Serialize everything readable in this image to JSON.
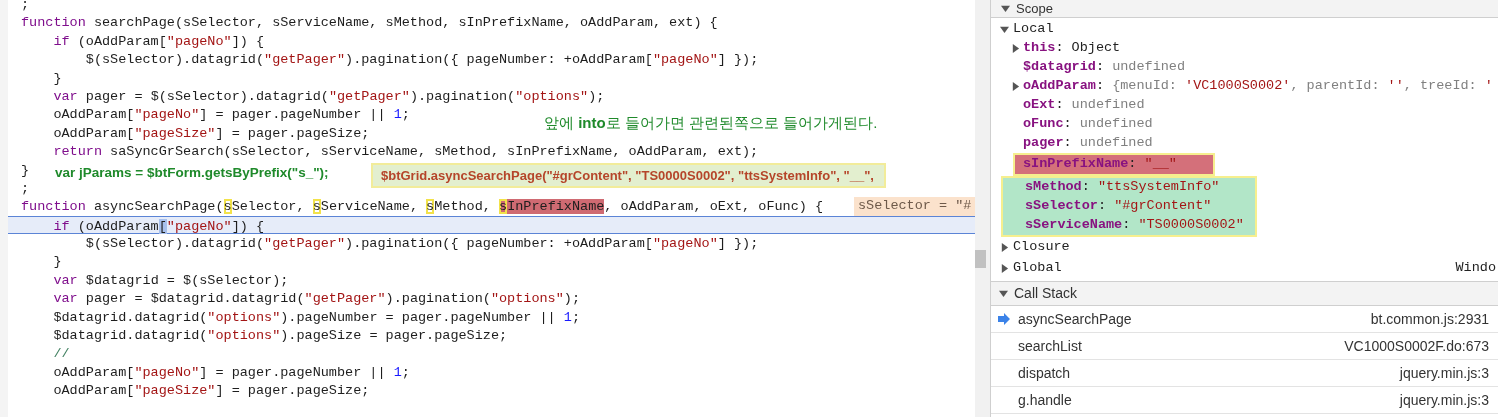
{
  "editor": {
    "lines": [
      {
        "current": false,
        "tokens": [
          {
            "t": ";"
          }
        ]
      },
      {
        "current": false,
        "tokens": [
          {
            "t": "function",
            "kind": "keyword"
          },
          {
            "t": " searchPage(sSelector, sServiceName, sMethod, sInPrefixName, oAddParam, ext) {"
          }
        ]
      },
      {
        "current": false,
        "tokens": [
          {
            "t": "    if",
            "kind": "keyword"
          },
          {
            "t": " (oAddParam["
          },
          {
            "t": "\"pageNo\"",
            "kind": "string"
          },
          {
            "t": "]) {"
          }
        ]
      },
      {
        "current": false,
        "tokens": [
          {
            "t": "        $(sSelector).datagrid("
          },
          {
            "t": "\"getPager\"",
            "kind": "string"
          },
          {
            "t": ").pagination({ pageNumber: +oAddParam["
          },
          {
            "t": "\"pageNo\"",
            "kind": "string"
          },
          {
            "t": "] });"
          }
        ]
      },
      {
        "current": false,
        "tokens": [
          {
            "t": "    }"
          }
        ]
      },
      {
        "current": false,
        "tokens": [
          {
            "t": "    var",
            "kind": "keyword"
          },
          {
            "t": " pager = $(sSelector).datagrid("
          },
          {
            "t": "\"getPager\"",
            "kind": "string"
          },
          {
            "t": ").pagination("
          },
          {
            "t": "\"options\"",
            "kind": "string"
          },
          {
            "t": ");"
          }
        ]
      },
      {
        "current": false,
        "tokens": [
          {
            "t": "    oAddParam["
          },
          {
            "t": "\"pageNo\"",
            "kind": "string"
          },
          {
            "t": "] = pager.pageNumber || "
          },
          {
            "t": "1",
            "kind": "number"
          },
          {
            "t": ";"
          }
        ]
      },
      {
        "current": false,
        "tokens": [
          {
            "t": "    oAddParam["
          },
          {
            "t": "\"pageSize\"",
            "kind": "string"
          },
          {
            "t": "] = pager.pageSize;"
          }
        ]
      },
      {
        "current": false,
        "tokens": [
          {
            "t": "    return",
            "kind": "keyword"
          },
          {
            "t": " saSyncGrSearch(sSelector, sServiceName, sMethod, sInPrefixName, oAddParam, ext);"
          }
        ]
      },
      {
        "current": false,
        "tokens": [
          {
            "t": "}"
          }
        ]
      },
      {
        "current": false,
        "tokens": [
          {
            "t": ";"
          }
        ]
      },
      {
        "current": false,
        "inline_value": "sSelector = \"#",
        "tokens": [
          {
            "t": "function",
            "kind": "keyword"
          },
          {
            "t": " asyncSearchPage("
          },
          {
            "t": "s",
            "outlined": true
          },
          {
            "t": "Selector, "
          },
          {
            "t": "s",
            "outlined": true
          },
          {
            "t": "ServiceName, "
          },
          {
            "t": "s",
            "outlined": true
          },
          {
            "t": "Method, "
          },
          {
            "t": "s",
            "outlined": true,
            "highlighted": true
          },
          {
            "t": "InPrefixName",
            "highlighted": true
          },
          {
            "t": ", oAddParam, oExt, oFunc) {"
          }
        ]
      },
      {
        "current": true,
        "tokens": [
          {
            "t": "    if",
            "kind": "keyword"
          },
          {
            "t": " (oAddParam"
          },
          {
            "t": "[",
            "cursor": true
          },
          {
            "t": "\"pageNo\"",
            "kind": "string"
          },
          {
            "t": "]) {"
          }
        ]
      },
      {
        "current": false,
        "tokens": [
          {
            "t": "        $(sSelector).datagrid("
          },
          {
            "t": "\"getPager\"",
            "kind": "string"
          },
          {
            "t": ").pagination({ pageNumber: +oAddParam["
          },
          {
            "t": "\"pageNo\"",
            "kind": "string"
          },
          {
            "t": "] });"
          }
        ]
      },
      {
        "current": false,
        "tokens": [
          {
            "t": "    }"
          }
        ]
      },
      {
        "current": false,
        "tokens": [
          {
            "t": "    var",
            "kind": "keyword"
          },
          {
            "t": " $datagrid = $(sSelector);"
          }
        ]
      },
      {
        "current": false,
        "tokens": [
          {
            "t": "    var",
            "kind": "keyword"
          },
          {
            "t": " pager = $datagrid.datagrid("
          },
          {
            "t": "\"getPager\"",
            "kind": "string"
          },
          {
            "t": ").pagination("
          },
          {
            "t": "\"options\"",
            "kind": "string"
          },
          {
            "t": ");"
          }
        ]
      },
      {
        "current": false,
        "tokens": [
          {
            "t": "    $datagrid.datagrid("
          },
          {
            "t": "\"options\"",
            "kind": "string"
          },
          {
            "t": ").pageNumber = pager.pageNumber || "
          },
          {
            "t": "1",
            "kind": "number"
          },
          {
            "t": ";"
          }
        ]
      },
      {
        "current": false,
        "tokens": [
          {
            "t": "    $datagrid.datagrid("
          },
          {
            "t": "\"options\"",
            "kind": "string"
          },
          {
            "t": ").pageSize = pager.pageSize;"
          }
        ]
      },
      {
        "current": false,
        "tokens": [
          {
            "t": "    //",
            "kind": "comment"
          }
        ]
      },
      {
        "current": false,
        "tokens": [
          {
            "t": "    oAddParam["
          },
          {
            "t": "\"pageNo\"",
            "kind": "string"
          },
          {
            "t": "] = pager.pageNumber || "
          },
          {
            "t": "1",
            "kind": "number"
          },
          {
            "t": ";"
          }
        ]
      },
      {
        "current": false,
        "tokens": [
          {
            "t": "    oAddParam["
          },
          {
            "t": "\"pageSize\"",
            "kind": "string"
          },
          {
            "t": "] = pager.pageSize;"
          }
        ]
      }
    ],
    "annotations": [
      {
        "kind": "note",
        "text": "앞에 **into**로 들어가면 관련된쪽으로 들어가게된다."
      },
      {
        "kind": "note",
        "text": "var jParams = $btForm.getsByPrefix(\"s_\");"
      },
      {
        "kind": "callout",
        "text": "$btGrid.asyncSearchPage(\"#grContent\", \"TS0000S0002\", \"ttsSystemInfo\", \"__\","
      }
    ]
  },
  "scope": {
    "title": "Scope",
    "expanded": true,
    "sections": [
      {
        "name": "Local",
        "expanded": true,
        "items": [
          {
            "name": "this",
            "expanded": false,
            "value": [
              {
                "t": ": "
              },
              {
                "t": "Object"
              }
            ]
          },
          {
            "name": "$datagrid",
            "value": [
              {
                "t": ": "
              },
              {
                "t": "undefined",
                "kind": "muted"
              }
            ]
          },
          {
            "name": "oAddParam",
            "expanded": false,
            "value": [
              {
                "t": ": "
              },
              {
                "t": "{menuId: ",
                "kind": "muted"
              },
              {
                "t": "'VC1000S0002'",
                "kind": "string"
              },
              {
                "t": ", parentId: ",
                "kind": "muted"
              },
              {
                "t": "''",
                "kind": "string"
              },
              {
                "t": ", treeId: ",
                "kind": "muted"
              },
              {
                "t": "'",
                "kind": "string"
              }
            ]
          },
          {
            "name": "oExt",
            "value": [
              {
                "t": ": "
              },
              {
                "t": "undefined",
                "kind": "muted"
              }
            ]
          },
          {
            "name": "oFunc",
            "value": [
              {
                "t": ": "
              },
              {
                "t": "undefined",
                "kind": "muted"
              }
            ]
          },
          {
            "name": "pager",
            "value": [
              {
                "t": ": "
              },
              {
                "t": "undefined",
                "kind": "muted"
              }
            ]
          },
          {
            "name": "sInPrefixName",
            "color": "#d4707a",
            "value": [
              {
                "t": ": "
              },
              {
                "t": "\"__\"",
                "kind": "string"
              }
            ]
          },
          {
            "name": "sMethod",
            "color": "#b2e6c8",
            "value": [
              {
                "t": ": "
              },
              {
                "t": "\"ttsSystemInfo\"",
                "kind": "string"
              }
            ]
          },
          {
            "name": "sSelector",
            "color": "#b2e6c8",
            "value": [
              {
                "t": ": "
              },
              {
                "t": "\"#grContent\"",
                "kind": "string"
              }
            ]
          },
          {
            "name": "sServiceName",
            "color": "#b2e6c8",
            "value": [
              {
                "t": ": "
              },
              {
                "t": "\"TS0000S0002\"",
                "kind": "string"
              }
            ]
          }
        ]
      },
      {
        "name": "Closure",
        "expanded": false
      },
      {
        "name": "Global",
        "expanded": false,
        "value": "Windo"
      }
    ]
  },
  "call_stack": {
    "title": "Call Stack",
    "expanded": true,
    "frames": [
      {
        "name": "asyncSearchPage",
        "location": "bt.common.js:2931",
        "selected": true
      },
      {
        "name": "searchList",
        "location": "VC1000S0002F.do:673",
        "selected": false
      },
      {
        "name": "dispatch",
        "location": "jquery.min.js:3",
        "selected": false
      },
      {
        "name": "g.handle",
        "location": "jquery.min.js:3",
        "selected": false
      }
    ]
  }
}
